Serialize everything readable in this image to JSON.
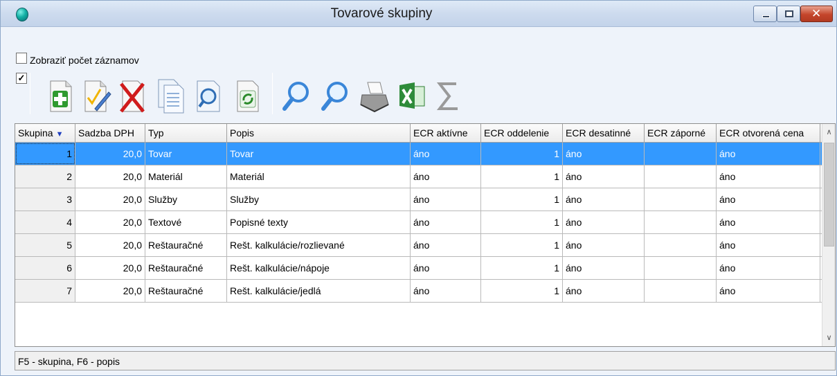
{
  "window": {
    "title": "Tovarové skupiny"
  },
  "options": {
    "show_count_label": "Zobraziť počet záznamov",
    "show_count_checked": false,
    "toolbar_check": "✓"
  },
  "toolbar": {
    "buttons": [
      {
        "name": "add-button",
        "icon": "plus-icon"
      },
      {
        "name": "edit-button",
        "icon": "edit-check-icon"
      },
      {
        "name": "delete-button",
        "icon": "delete-x-icon"
      },
      {
        "name": "copy-button",
        "icon": "copy-document-icon"
      },
      {
        "name": "preview-button",
        "icon": "document-search-icon"
      },
      {
        "name": "refresh-button",
        "icon": "refresh-icon"
      },
      {
        "name": "find-button",
        "icon": "magnifier-icon"
      },
      {
        "name": "find-next-button",
        "icon": "magnifier-icon"
      },
      {
        "name": "print-button",
        "icon": "printer-icon"
      },
      {
        "name": "export-excel-button",
        "icon": "excel-icon"
      },
      {
        "name": "sum-button",
        "icon": "sigma-icon"
      }
    ]
  },
  "grid": {
    "columns": [
      "Skupina",
      "Sadzba DPH",
      "Typ",
      "Popis",
      "ECR aktívne",
      "ECR oddelenie",
      "ECR desatinné",
      "ECR záporné",
      "ECR otvorená cena"
    ],
    "sort_indicator": "▼",
    "rows": [
      [
        "1",
        "20,0",
        "Tovar",
        "Tovar",
        "áno",
        "1",
        "áno",
        "",
        "áno"
      ],
      [
        "2",
        "20,0",
        "Materiál",
        "Materiál",
        "áno",
        "1",
        "áno",
        "",
        "áno"
      ],
      [
        "3",
        "20,0",
        "Služby",
        "Služby",
        "áno",
        "1",
        "áno",
        "",
        "áno"
      ],
      [
        "4",
        "20,0",
        "Textové",
        "Popisné texty",
        "áno",
        "1",
        "áno",
        "",
        "áno"
      ],
      [
        "5",
        "20,0",
        "Reštauračné",
        "Rešt. kalkulácie/rozlievané",
        "áno",
        "1",
        "áno",
        "",
        "áno"
      ],
      [
        "6",
        "20,0",
        "Reštauračné",
        "Rešt. kalkulácie/nápoje",
        "áno",
        "1",
        "áno",
        "",
        "áno"
      ],
      [
        "7",
        "20,0",
        "Reštauračné",
        "Rešt. kalkulácie/jedlá",
        "áno",
        "1",
        "áno",
        "",
        "áno"
      ]
    ],
    "selected_row": 0
  },
  "status": {
    "text": "F5 - skupina, F6 - popis"
  },
  "colors": {
    "selection": "#3399ff",
    "title_bar": "#cddbee"
  }
}
